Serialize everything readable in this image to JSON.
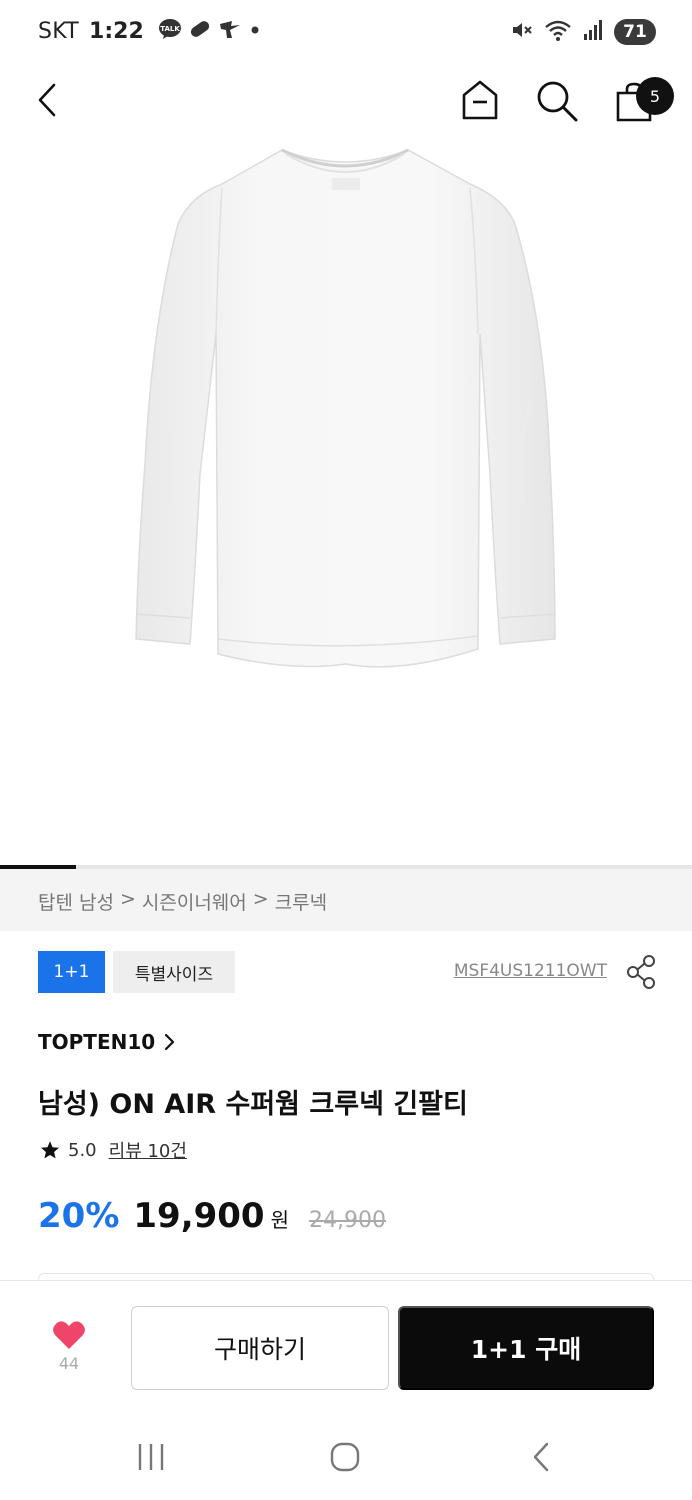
{
  "status_bar": {
    "carrier": "SKT",
    "time": "1:22",
    "battery_level": "71",
    "notification_icons": [
      "talk-icon",
      "pill-icon",
      "app-icon",
      "dot-icon"
    ],
    "system_icons": [
      "mute-icon",
      "wifi-icon",
      "signal-icon"
    ]
  },
  "header": {
    "cart_count": "5"
  },
  "gallery": {
    "progress_fraction": 0.11
  },
  "breadcrumb": {
    "items": [
      "탑텐 남성",
      "시즌이너웨어",
      "크루넥"
    ],
    "separator": ">"
  },
  "tags": {
    "promo": "1+1",
    "size": "특별사이즈"
  },
  "product": {
    "code": "MSF4US1211OWT",
    "brand": "TOPTEN10",
    "title": "남성) ON AIR 수퍼웜 크루넥 긴팔티",
    "rating": "5.0",
    "review_label": "리뷰 10건"
  },
  "price": {
    "discount": "20%",
    "sale_price": "19,900",
    "currency": "원",
    "original_price": "24,900"
  },
  "actions": {
    "like_count": "44",
    "buy_label": "구매하기",
    "buy_11_label": "1+1 구매"
  },
  "colors": {
    "accent_blue": "#1a73e8",
    "like_pink": "#f0456b",
    "dark_button": "#0b0b0b"
  }
}
